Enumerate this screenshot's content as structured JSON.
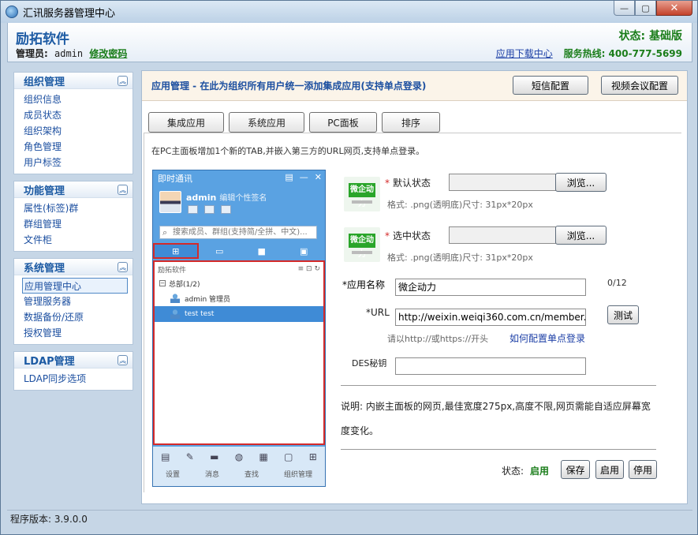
{
  "window": {
    "title": "汇讯服务器管理中心",
    "min": "—",
    "max": "▢",
    "close": "✕"
  },
  "header": {
    "brand": "励拓软件",
    "admin_label": "管理员:",
    "admin_user": "admin",
    "change_password": "修改密码",
    "status": "状态: 基础版",
    "download": "应用下载中心",
    "hotline": "服务热线: 400-777-5699"
  },
  "sidebar": {
    "sections": [
      {
        "title": "组织管理",
        "items": [
          "组织信息",
          "成员状态",
          "组织架构",
          "角色管理",
          "用户标签"
        ]
      },
      {
        "title": "功能管理",
        "items": [
          "属性(标签)群",
          "群组管理",
          "文件柜"
        ]
      },
      {
        "title": "系统管理",
        "items": [
          "应用管理中心",
          "管理服务器",
          "数据备份/还原",
          "授权管理"
        ]
      },
      {
        "title": "LDAP管理",
        "items": [
          "LDAP同步选项"
        ]
      }
    ]
  },
  "main": {
    "title": "应用管理 - 在此为组织所有用户统一添加集成应用(支持单点登录)",
    "sms_button": "短信配置",
    "video_button": "视频会议配置",
    "tabs": [
      "集成应用",
      "系统应用",
      "PC面板",
      "排序"
    ],
    "description": "在PC主面板增加1个新的TAB,并嵌入第三方的URL网页,支持单点登录。"
  },
  "preview": {
    "title": "即时通讯",
    "username": "admin",
    "signature": "编辑个性签名",
    "search_placeholder": "搜索成员、群组(支持简/全拼、中文)...",
    "list_header": "励拓软件",
    "group": "总部(1/2)",
    "users": [
      "admin 管理员",
      "test test"
    ],
    "footer": [
      "设置",
      "消息",
      "查找",
      "组织管理"
    ]
  },
  "form": {
    "default_state_label": "默认状态",
    "selected_state_label": "选中状态",
    "browse": "浏览...",
    "format_hint": "格式: .png(透明底)尺寸: 31px*20px",
    "app_name_label": "*应用名称",
    "app_name_value": "微企动力",
    "app_name_count": "0/12",
    "url_label": "*URL",
    "url_value": "http://weixin.weiqi360.com.cn/member.ph",
    "test": "测试",
    "url_hint": "请以http://或https://开头",
    "sso_link": "如何配置单点登录",
    "des_label": "DES秘钥",
    "des_value": "",
    "note": "说明: 内嵌主面板的网页,最佳宽度275px,高度不限,网页需能自适应屏幕宽度变化。",
    "status_label": "状态:",
    "status_value": "启用",
    "save": "保存",
    "enable": "启用",
    "disable": "停用",
    "icon_text": "微企动力"
  },
  "footer": {
    "version": "程序版本: 3.9.0.0"
  }
}
